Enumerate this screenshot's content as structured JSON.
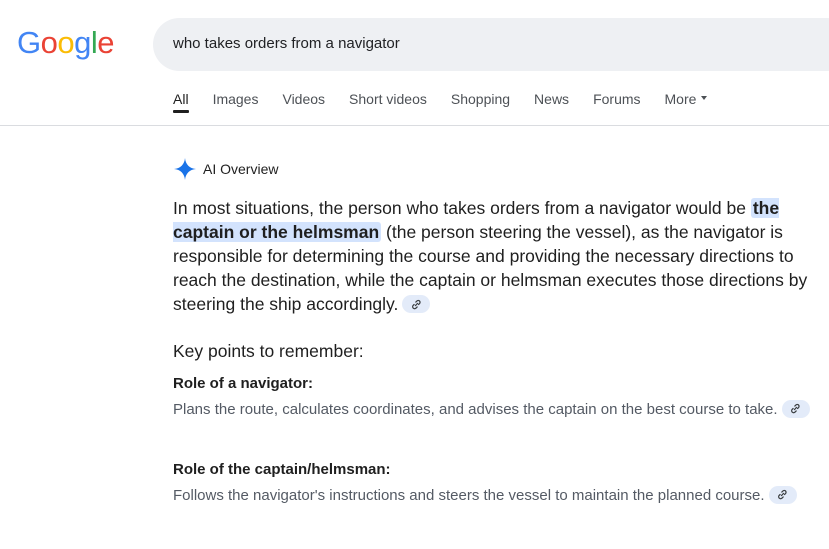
{
  "logo": {
    "letters": [
      "G",
      "o",
      "o",
      "g",
      "l",
      "e"
    ],
    "colors": [
      "#4285f4",
      "#ea4335",
      "#fbbc05",
      "#4285f4",
      "#34a853",
      "#ea4335"
    ]
  },
  "search": {
    "query": "who takes orders from a navigator"
  },
  "tabs": [
    {
      "label": "All",
      "active": true
    },
    {
      "label": "Images"
    },
    {
      "label": "Videos"
    },
    {
      "label": "Short videos"
    },
    {
      "label": "Shopping"
    },
    {
      "label": "News"
    },
    {
      "label": "Forums"
    },
    {
      "label": "More"
    }
  ],
  "ai_overview": {
    "title": "AI Overview",
    "icon": "sparkle-icon",
    "accent": "#1a73e8",
    "summary_before": "In most situations, the person who takes orders from a navigator would be ",
    "summary_highlight": "the captain or the helmsman",
    "summary_after": " (the person steering the vessel), as the navigator is responsible for determining the course and providing the necessary directions to reach the destination, while the captain or helmsman executes those directions by steering the ship accordingly.",
    "key_points_title": "Key points to remember:",
    "points": [
      {
        "title": "Role of a navigator:",
        "body": "Plans the route, calculates coordinates, and advises the captain on the best course to take."
      },
      {
        "title": "Role of the captain/helmsman:",
        "body": "Follows the navigator's instructions and steers the vessel to maintain the planned course."
      }
    ]
  }
}
